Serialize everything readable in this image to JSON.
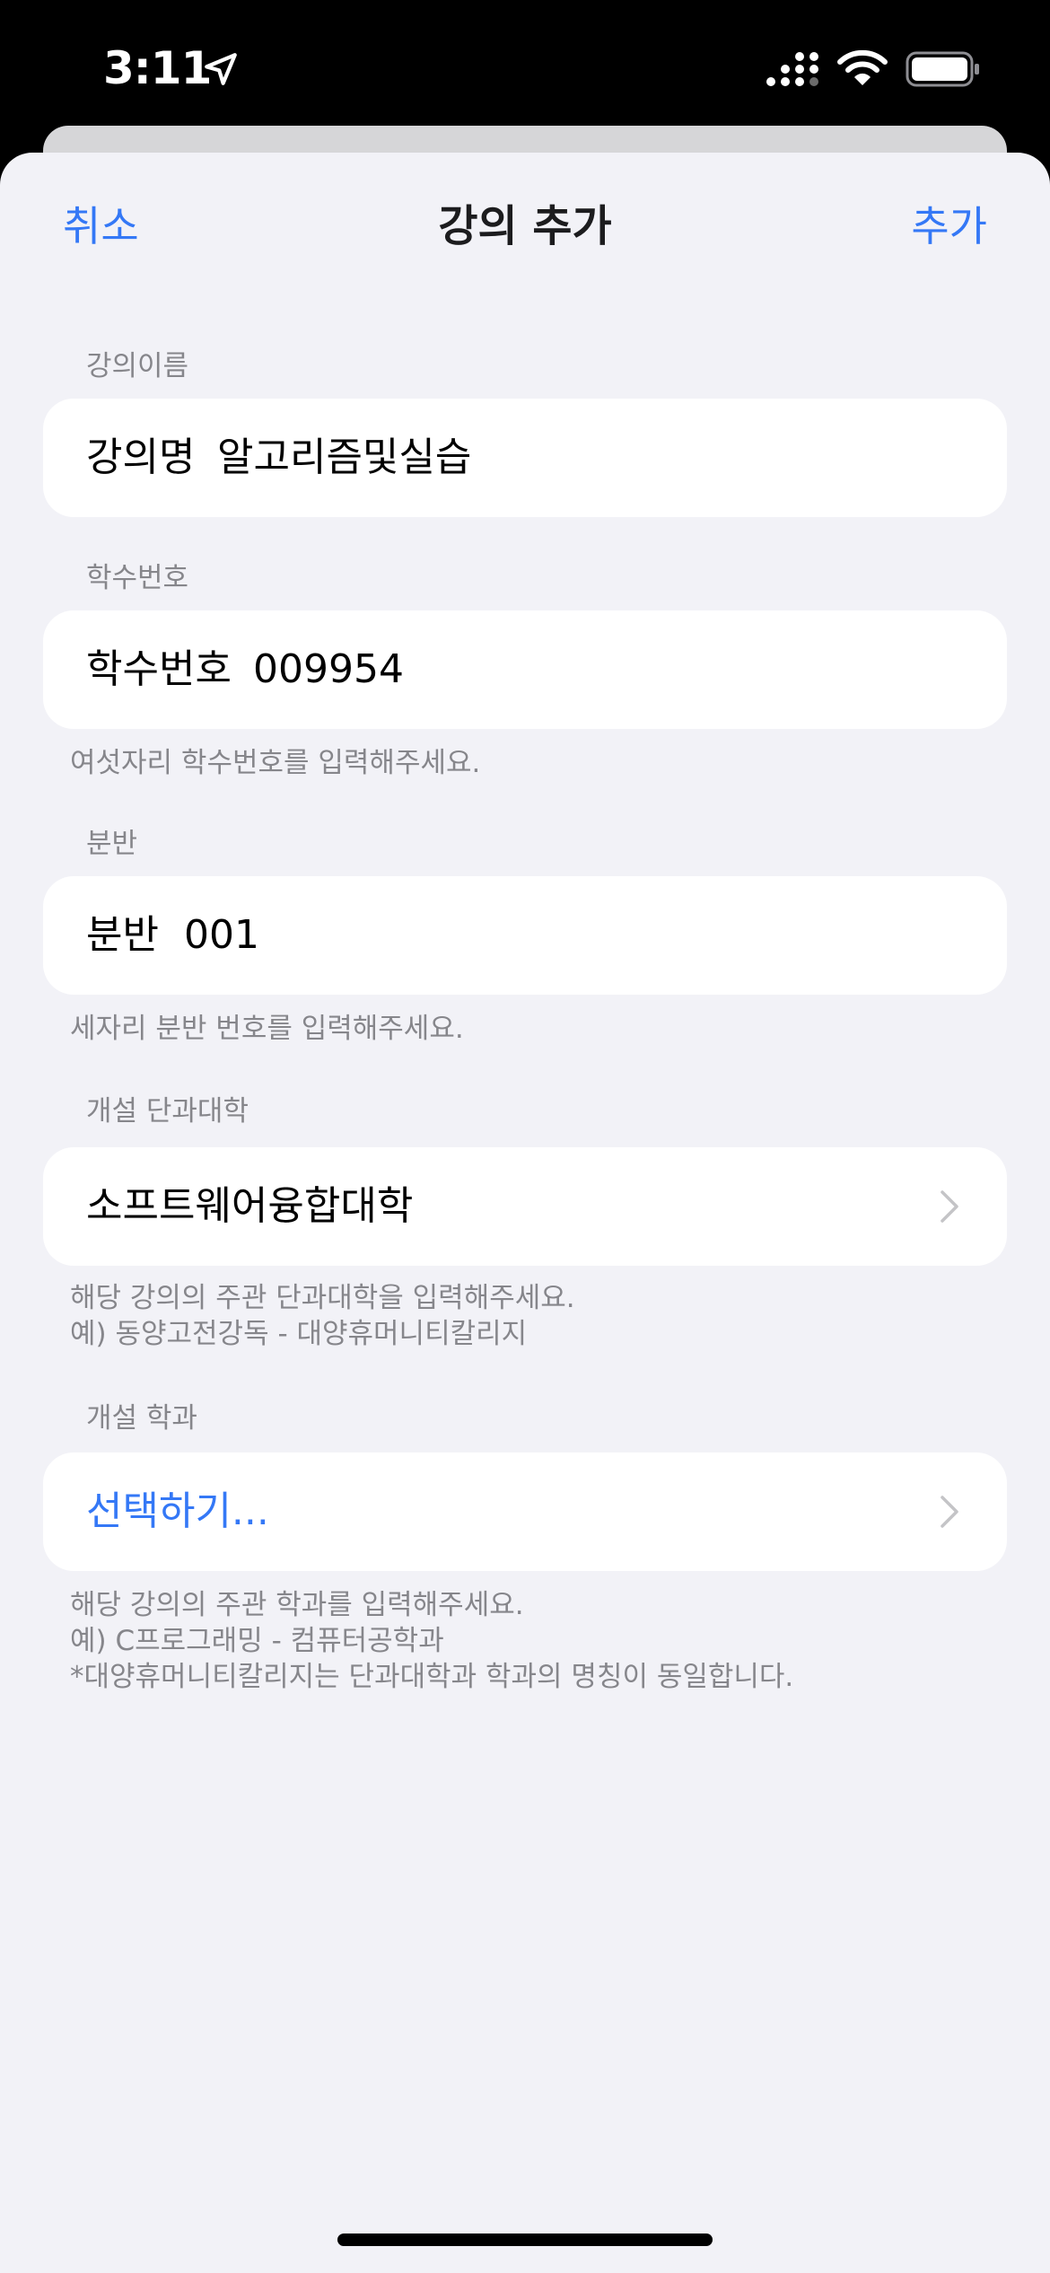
{
  "status_bar": {
    "time": "3:11",
    "icons": [
      "location-arrow-icon",
      "cellular-signal-icon",
      "wifi-icon",
      "battery-icon"
    ]
  },
  "nav": {
    "cancel": "취소",
    "title": "강의 추가",
    "add": "추가"
  },
  "colors": {
    "accent": "#3478f6",
    "background": "#f2f2f7",
    "card": "#ffffff",
    "secondary_text": "#86868b"
  },
  "sections": {
    "course_name": {
      "header": "강의이름",
      "label": "강의명",
      "value": "알고리즘및실습"
    },
    "course_code": {
      "header": "학수번호",
      "label": "학수번호",
      "value": "009954",
      "footer": "여섯자리 학수번호를 입력해주세요."
    },
    "section_no": {
      "header": "분반",
      "label": "분반",
      "value": "001",
      "footer": "세자리 분반 번호를 입력해주세요."
    },
    "college": {
      "header": "개설 단과대학",
      "value": "소프트웨어융합대학",
      "footer": [
        "해당 강의의 주관 단과대학을 입력해주세요.",
        "예) 동양고전강독 - 대양휴머니티칼리지"
      ]
    },
    "department": {
      "header": "개설 학과",
      "value": "선택하기...",
      "footer": [
        "해당 강의의 주관 학과를 입력해주세요.",
        "예) C프로그래밍 - 컴퓨터공학과",
        "*대양휴머니티칼리지는 단과대학과 학과의 명칭이 동일합니다."
      ]
    }
  }
}
